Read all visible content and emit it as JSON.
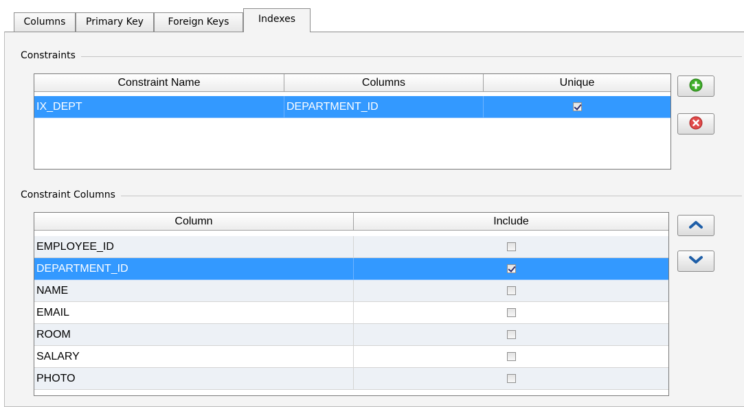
{
  "tabs": [
    {
      "label": "Columns"
    },
    {
      "label": "Primary Key"
    },
    {
      "label": "Foreign Keys"
    },
    {
      "label": "Indexes",
      "active": true
    }
  ],
  "constraints": {
    "title": "Constraints",
    "headers": [
      "Constraint Name",
      "Columns",
      "Unique"
    ],
    "rows": [
      {
        "name": "IX_DEPT",
        "columns": "DEPARTMENT_ID",
        "unique": true,
        "selected": true
      }
    ],
    "add_icon": "add-icon",
    "remove_icon": "remove-icon"
  },
  "constraint_columns": {
    "title": "Constraint Columns",
    "headers": [
      "Column",
      "Include"
    ],
    "rows": [
      {
        "column": "EMPLOYEE_ID",
        "include": false
      },
      {
        "column": "DEPARTMENT_ID",
        "include": true,
        "selected": true
      },
      {
        "column": "NAME",
        "include": false
      },
      {
        "column": "EMAIL",
        "include": false
      },
      {
        "column": "ROOM",
        "include": false
      },
      {
        "column": "SALARY",
        "include": false
      },
      {
        "column": "PHOTO",
        "include": false
      }
    ],
    "up_icon": "move-up-icon",
    "down_icon": "move-down-icon"
  },
  "colors": {
    "selection": "#3399ff",
    "alt_row": "#edf1f6"
  }
}
